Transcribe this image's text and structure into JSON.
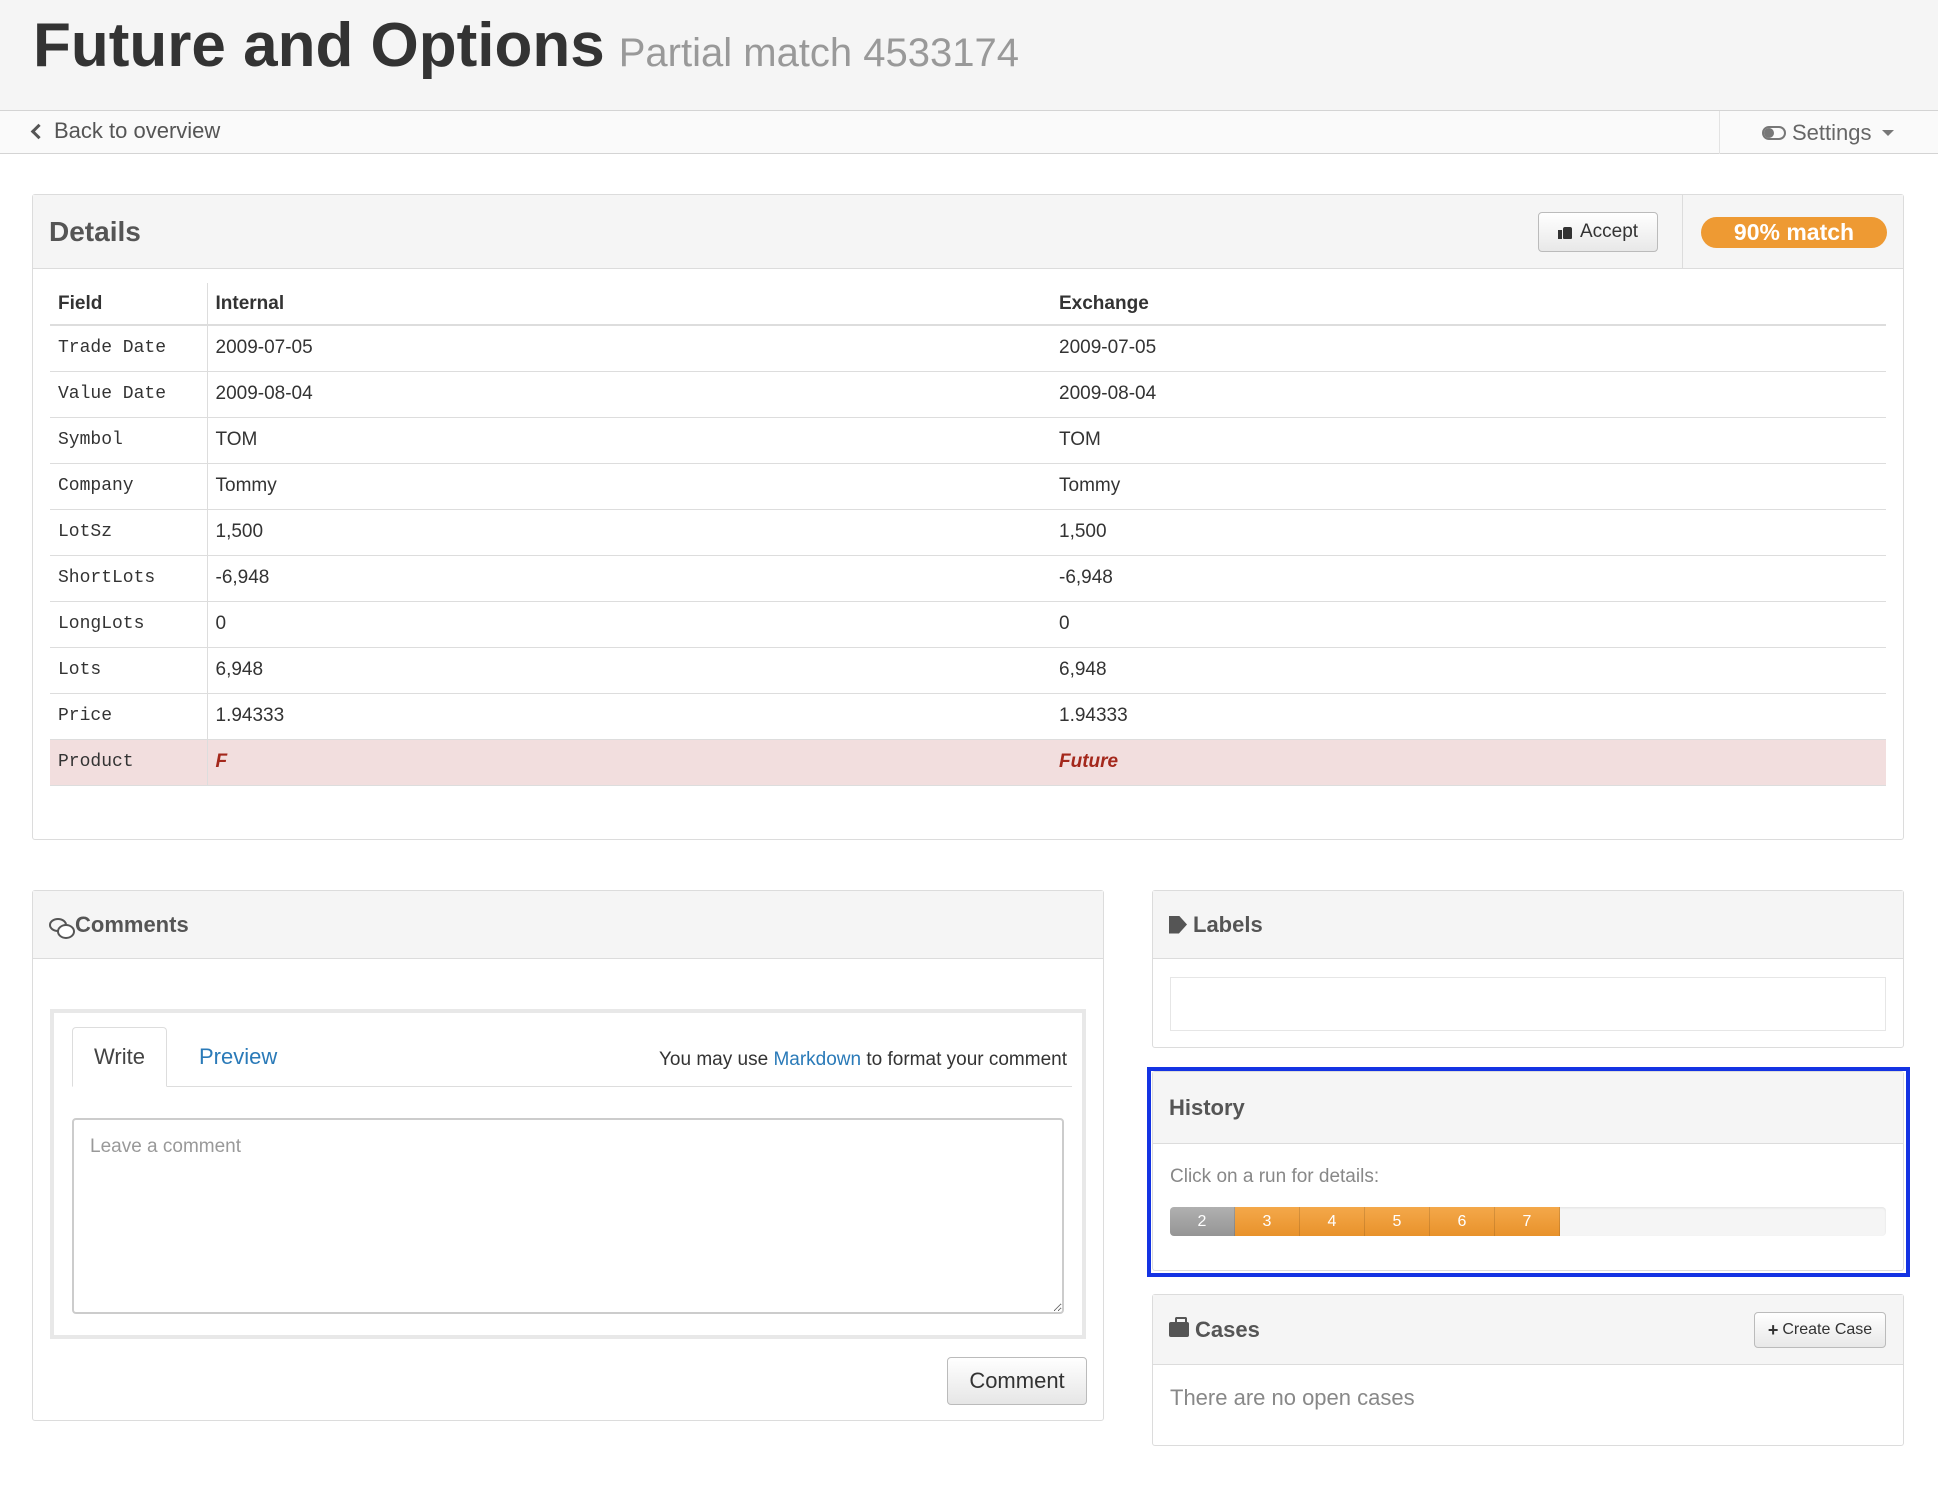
{
  "header": {
    "title": "Future and Options",
    "subtitle": "Partial match 4533174"
  },
  "subnav": {
    "back_label": "Back to overview",
    "settings_label": "Settings"
  },
  "details": {
    "title": "Details",
    "accept_label": "Accept",
    "match_badge": "90% match",
    "match_color": "#ee9a33",
    "mismatch_color": "#f2dede",
    "columns": [
      "Field",
      "Internal",
      "Exchange"
    ],
    "rows": [
      {
        "field": "Trade Date",
        "internal": "2009-07-05",
        "exchange": "2009-07-05"
      },
      {
        "field": "Value Date",
        "internal": "2009-08-04",
        "exchange": "2009-08-04"
      },
      {
        "field": "Symbol",
        "internal": "TOM",
        "exchange": "TOM"
      },
      {
        "field": "Company",
        "internal": "Tommy",
        "exchange": "Tommy"
      },
      {
        "field": "LotSz",
        "internal": "1,500",
        "exchange": "1,500"
      },
      {
        "field": "ShortLots",
        "internal": "-6,948",
        "exchange": "-6,948"
      },
      {
        "field": "LongLots",
        "internal": "0",
        "exchange": "0"
      },
      {
        "field": "Lots",
        "internal": "6,948",
        "exchange": "6,948"
      },
      {
        "field": "Price",
        "internal": "1.94333",
        "exchange": "1.94333"
      },
      {
        "field": "Product",
        "internal": "F",
        "exchange": "Future",
        "mismatch": true
      }
    ]
  },
  "comments": {
    "title": "Comments",
    "tab_write": "Write",
    "tab_preview": "Preview",
    "markdown_prefix": "You may use",
    "markdown_link": "Markdown",
    "markdown_suffix": "to format your comment",
    "placeholder": "Leave a comment",
    "submit_label": "Comment"
  },
  "labels": {
    "title": "Labels"
  },
  "history": {
    "title": "History",
    "hint": "Click on a run for details:",
    "highlight_color": "#1433e3",
    "runs": [
      {
        "label": "2",
        "status": "grey"
      },
      {
        "label": "3",
        "status": "orange"
      },
      {
        "label": "4",
        "status": "orange"
      },
      {
        "label": "5",
        "status": "orange"
      },
      {
        "label": "6",
        "status": "orange"
      },
      {
        "label": "7",
        "status": "orange"
      }
    ]
  },
  "cases": {
    "title": "Cases",
    "create_label": "Create Case",
    "empty_text": "There are no open cases"
  }
}
